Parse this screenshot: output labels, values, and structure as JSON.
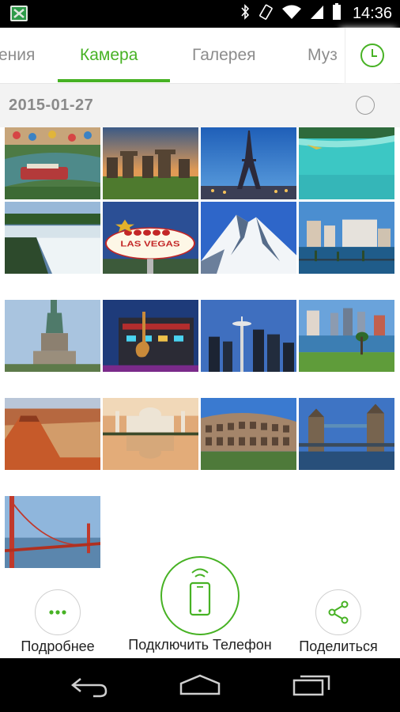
{
  "status_bar": {
    "time": "14:36",
    "icons": [
      "app-notification-icon",
      "bluetooth-icon",
      "vibrate-icon",
      "wifi-icon",
      "signal-icon",
      "battery-icon"
    ]
  },
  "tabs": {
    "items": [
      {
        "label": "ения",
        "active": false
      },
      {
        "label": "Камера",
        "active": true
      },
      {
        "label": "Галерея",
        "active": false
      },
      {
        "label": "Муз",
        "active": false
      }
    ],
    "history_icon": "clock-icon"
  },
  "colors": {
    "accent": "#47b224",
    "inactive_tab": "#8c8c8c",
    "date_bg": "#f3f3f3"
  },
  "section": {
    "date": "2015-01-27"
  },
  "photos": [
    {
      "subject": "river-walk-boats"
    },
    {
      "subject": "stonehenge"
    },
    {
      "subject": "eiffel-tower"
    },
    {
      "subject": "tropical-beach"
    },
    {
      "subject": "waterfall"
    },
    {
      "subject": "las-vegas-sign"
    },
    {
      "subject": "snowy-mountain"
    },
    {
      "subject": "city-waterfront"
    },
    {
      "subject": "statue-of-liberty"
    },
    {
      "subject": "hard-rock-cafe"
    },
    {
      "subject": "space-needle"
    },
    {
      "subject": "city-park-lake"
    },
    {
      "subject": "red-canyon"
    },
    {
      "subject": "taj-mahal"
    },
    {
      "subject": "colosseum"
    },
    {
      "subject": "tower-bridge"
    },
    {
      "subject": "golden-gate-bridge"
    }
  ],
  "actions": {
    "more_label": "Подробнее",
    "connect_label": "Подключить Телефон",
    "share_label": "Поделиться"
  },
  "nav_bar": {
    "icons": [
      "back-icon",
      "home-icon",
      "recents-icon"
    ]
  }
}
